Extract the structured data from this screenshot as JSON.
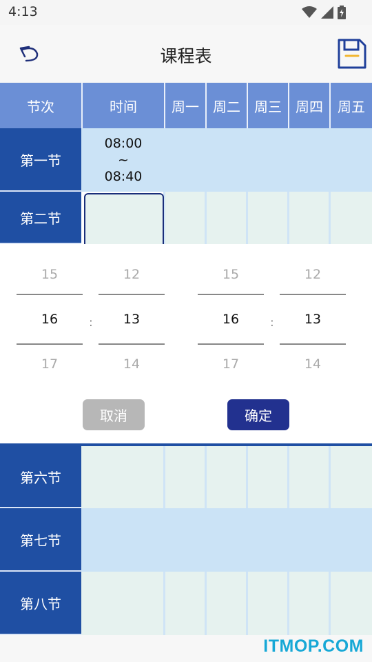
{
  "status_bar": {
    "time": "4:13",
    "icons": [
      "wifi-icon",
      "signal-icon",
      "battery-icon"
    ]
  },
  "app_bar": {
    "title": "课程表",
    "back_icon": "back-arrow-icon",
    "save_icon": "save-icon"
  },
  "table": {
    "headers": [
      "节次",
      "时间",
      "周一",
      "周二",
      "周三",
      "周四",
      "周五"
    ],
    "rows": [
      {
        "label": "第一节",
        "time_start": "08:00",
        "time_sep": "~",
        "time_end": "08:40"
      },
      {
        "label": "第二节"
      },
      {
        "label": "第六节"
      },
      {
        "label": "第七节"
      },
      {
        "label": "第八节"
      }
    ]
  },
  "time_picker": {
    "start": {
      "hour": {
        "prev": "15",
        "current": "16",
        "next": "17"
      },
      "minute": {
        "prev": "12",
        "current": "13",
        "next": "14"
      }
    },
    "end": {
      "hour": {
        "prev": "15",
        "current": "16",
        "next": "17"
      },
      "minute": {
        "prev": "12",
        "current": "13",
        "next": "14"
      }
    },
    "separator": ":",
    "cancel_label": "取消",
    "confirm_label": "确定"
  },
  "watermark": "ITMOP.COM",
  "colors": {
    "header": "#6b8fd6",
    "row_label": "#1f4fa3",
    "cell": "#e6f2ef",
    "cell_highlight": "#cbe3f6",
    "confirm": "#22318f",
    "cancel": "#b7b7b7",
    "watermark": "#17a8d6"
  }
}
